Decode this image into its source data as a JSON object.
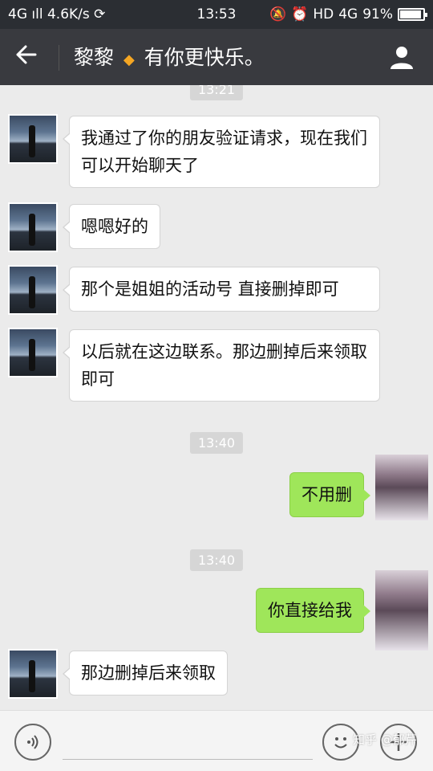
{
  "status_bar": {
    "network": "4G",
    "speed": "4.6K/s",
    "time": "13:53",
    "hd": "HD",
    "network_right": "4G",
    "battery": "91%"
  },
  "header": {
    "name": "黎黎",
    "diamond": "◆",
    "subtitle": "有你更快乐。"
  },
  "messages": {
    "time_top": "13:21",
    "m1": "我通过了你的朋友验证请求，现在我们可以开始聊天了",
    "m2": "嗯嗯好的",
    "m3": "那个是姐姐的活动号 直接删掉即可",
    "m4": "以后就在这边联系。那边删掉后来领取即可",
    "time_1": "13:40",
    "m5": "不用删",
    "time_2": "13:40",
    "m6": "你直接给我",
    "m7": "那边删掉后来领取"
  },
  "watermark": "知乎 @郁芹",
  "icons": {
    "back": "back-arrow-icon",
    "profile": "person-icon",
    "voice": "voice-icon",
    "emoji": "emoji-icon",
    "plus": "plus-icon"
  }
}
